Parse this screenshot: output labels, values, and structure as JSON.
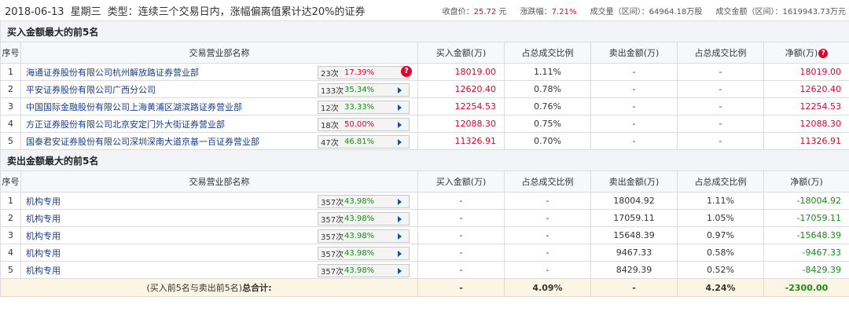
{
  "header": {
    "date": "2018-06-13",
    "weekday": "星期三",
    "type_label": "类型：连续三个交易日内，涨幅偏离值累计达20%的证券",
    "close_label": "收盘价：",
    "close_value": "25.72",
    "close_unit": "元",
    "change_label": "涨跌幅：",
    "change_value": "7.21%",
    "volume_text": "成交量（区间）：64964.18万股",
    "amount_text": "成交金额（区间）：1619943.73万元"
  },
  "buy": {
    "title": "买入金额最大的前5名",
    "columns": [
      "序号",
      "交易营业部名称",
      "买入金额(万)",
      "占总成交比例",
      "卖出金额(万)",
      "占总成交比例",
      "净额(万)"
    ],
    "rows": [
      {
        "no": "1",
        "name": "海通证券股份有限公司杭州解放路证券营业部",
        "times": "23次",
        "pct": "17.39%",
        "pct_color": "red",
        "buy": "18019.00",
        "buy_ratio": "1.11%",
        "sell": "-",
        "sell_ratio": "-",
        "net": "18019.00",
        "icon": "question-icon"
      },
      {
        "no": "2",
        "name": "平安证券股份有限公司广西分公司",
        "times": "133次",
        "pct": "35.34%",
        "pct_color": "green",
        "buy": "12620.40",
        "buy_ratio": "0.78%",
        "sell": "-",
        "sell_ratio": "-",
        "net": "12620.40",
        "icon": "play-icon"
      },
      {
        "no": "3",
        "name": "中国国际金融股份有限公司上海黄浦区湖滨路证券营业部",
        "times": "12次",
        "pct": "33.33%",
        "pct_color": "green",
        "buy": "12254.53",
        "buy_ratio": "0.76%",
        "sell": "-",
        "sell_ratio": "-",
        "net": "12254.53",
        "icon": "play-icon"
      },
      {
        "no": "4",
        "name": "方正证券股份有限公司北京安定门外大街证券营业部",
        "times": "18次",
        "pct": "50.00%",
        "pct_color": "red",
        "buy": "12088.30",
        "buy_ratio": "0.75%",
        "sell": "-",
        "sell_ratio": "-",
        "net": "12088.30",
        "icon": "play-icon"
      },
      {
        "no": "5",
        "name": "国泰君安证券股份有限公司深圳深南大道京基一百证券营业部",
        "times": "47次",
        "pct": "46.81%",
        "pct_color": "green",
        "buy": "11326.91",
        "buy_ratio": "0.70%",
        "sell": "-",
        "sell_ratio": "-",
        "net": "11326.91",
        "icon": "play-icon"
      }
    ]
  },
  "sell": {
    "title": "卖出金额最大的前5名",
    "columns": [
      "序号",
      "交易营业部名称",
      "买入金额(万)",
      "占总成交比例",
      "卖出金额(万)",
      "占总成交比例",
      "净额(万)"
    ],
    "rows": [
      {
        "no": "1",
        "name": "机构专用",
        "times": "357次",
        "pct": "43.98%",
        "pct_color": "green",
        "buy": "-",
        "buy_ratio": "-",
        "sell": "18004.92",
        "sell_ratio": "1.11%",
        "net": "-18004.92",
        "icon": "play-icon"
      },
      {
        "no": "2",
        "name": "机构专用",
        "times": "357次",
        "pct": "43.98%",
        "pct_color": "green",
        "buy": "-",
        "buy_ratio": "-",
        "sell": "17059.11",
        "sell_ratio": "1.05%",
        "net": "-17059.11",
        "icon": "play-icon"
      },
      {
        "no": "3",
        "name": "机构专用",
        "times": "357次",
        "pct": "43.98%",
        "pct_color": "green",
        "buy": "-",
        "buy_ratio": "-",
        "sell": "15648.39",
        "sell_ratio": "0.97%",
        "net": "-15648.39",
        "icon": "play-icon"
      },
      {
        "no": "4",
        "name": "机构专用",
        "times": "357次",
        "pct": "43.98%",
        "pct_color": "green",
        "buy": "-",
        "buy_ratio": "-",
        "sell": "9467.33",
        "sell_ratio": "0.58%",
        "net": "-9467.33",
        "icon": "play-icon"
      },
      {
        "no": "5",
        "name": "机构专用",
        "times": "357次",
        "pct": "43.98%",
        "pct_color": "green",
        "buy": "-",
        "buy_ratio": "-",
        "sell": "8429.39",
        "sell_ratio": "0.52%",
        "net": "-8429.39",
        "icon": "play-icon"
      }
    ]
  },
  "total": {
    "label_prefix": "(买入前5名与卖出前5名)",
    "label_bold": "总合计:",
    "buy": "-",
    "buy_ratio": "4.09%",
    "sell": "-",
    "sell_ratio": "4.24%",
    "net": "-2300.00"
  },
  "colors": {
    "up": "#e4002b",
    "down": "#1a8a1a",
    "link": "#1a3d8f",
    "section_bg": "#f2f4f8",
    "total_bg": "#fcf5e3"
  }
}
